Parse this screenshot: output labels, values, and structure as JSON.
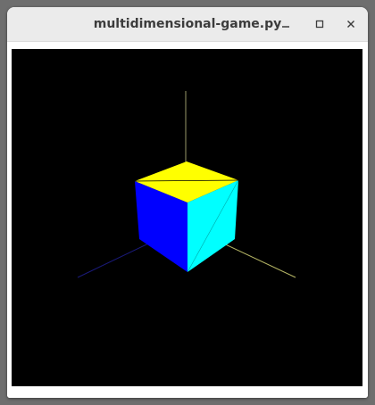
{
  "window": {
    "title": "multidimensional-game.py",
    "icons": {
      "minimize": "minimize-icon",
      "maximize": "maximize-icon",
      "close": "close-icon"
    }
  },
  "scene": {
    "background": "#000000",
    "axis_colors": {
      "vertical": "#9a9a6a",
      "left": "#1a1a7a",
      "right": "#b4b464"
    },
    "cube_colors": {
      "top": "#ffff00",
      "left": "#0000ff",
      "right": "#00ffff",
      "edge": "#000000"
    }
  }
}
